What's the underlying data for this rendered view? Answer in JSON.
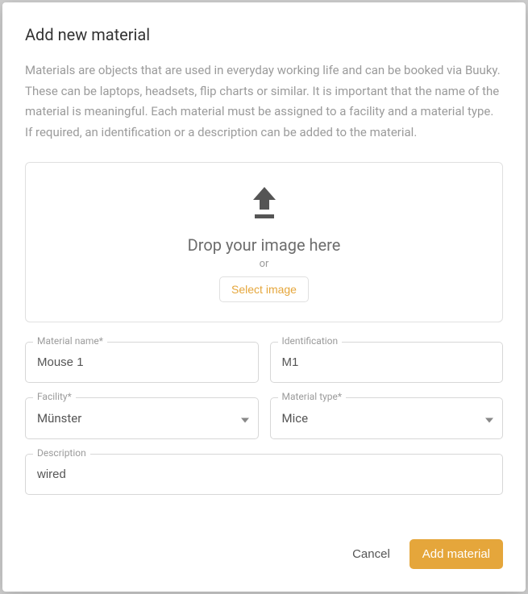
{
  "modal": {
    "title": "Add new material",
    "description": "Materials are objects that are used in everyday working life and can be booked via Buuky. These can be laptops, headsets, flip charts or similar. It is important that the name of the material is meaningful. Each material must be assigned to a facility and a material type. If required, an identification or a description can be added to the material."
  },
  "dropzone": {
    "drop_text": "Drop your image here",
    "or_text": "or",
    "select_button": "Select image"
  },
  "form": {
    "material_name": {
      "label": "Material name*",
      "value": "Mouse 1"
    },
    "identification": {
      "label": "Identification",
      "value": "M1"
    },
    "facility": {
      "label": "Facility*",
      "value": "Münster"
    },
    "material_type": {
      "label": "Material type*",
      "value": "Mice"
    },
    "description": {
      "label": "Description",
      "value": "wired"
    }
  },
  "footer": {
    "cancel": "Cancel",
    "submit": "Add material"
  }
}
